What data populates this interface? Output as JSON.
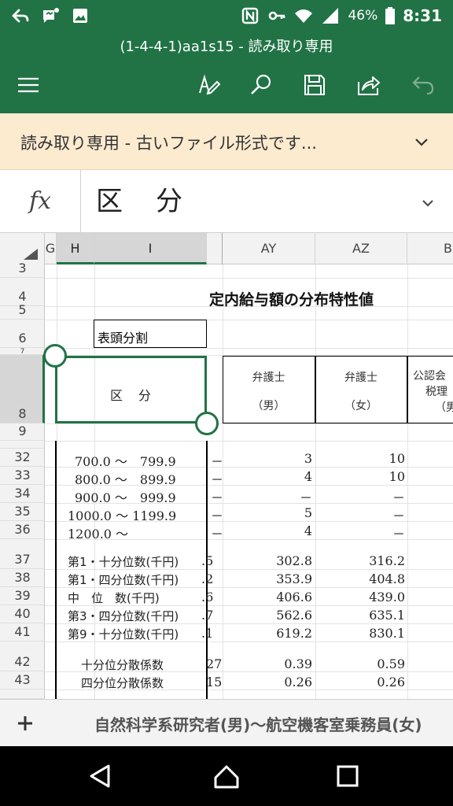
{
  "status": {
    "battery": "46%",
    "time": "8:31",
    "icons": [
      "back-arrow-icon",
      "messenger-icon",
      "image-icon",
      "nfc-icon",
      "key-icon",
      "wifi-icon",
      "signal-icon",
      "battery-icon"
    ]
  },
  "appbar": {
    "title": "(1-4-4-1)aa1s15 - 読み取り専用",
    "icons": [
      "menu-icon",
      "draw-icon",
      "search-icon",
      "save-icon",
      "share-icon",
      "undo-icon"
    ]
  },
  "banner": {
    "text": "読み取り専用 - 古いファイル形式です..."
  },
  "formula": {
    "fx": "fx",
    "value": "区　分"
  },
  "columns": [
    "G",
    "H",
    "I",
    "AY",
    "AZ",
    "B"
  ],
  "rows": {
    "r3": "3",
    "r4": "4",
    "r5": "5",
    "r6": "6",
    "r7": "7",
    "r8": "8",
    "r9": "9",
    "r32": "32",
    "r33": "33",
    "r34": "34",
    "r35": "35",
    "r36": "36",
    "r37": "37",
    "r38": "38",
    "r39": "39",
    "r40": "40",
    "r41": "41",
    "r42": "42",
    "r43": "43"
  },
  "cells": {
    "title": "定内給与額の分布特性値",
    "hyoto": "表頭分割",
    "kubun": "区　分",
    "ay_header1": "弁護士",
    "ay_header2": "（男）",
    "az_header1": "弁護士",
    "az_header2": "（女）",
    "b_header1": "公認会",
    "b_header2": "税理",
    "b_header3": "（男"
  },
  "data_rows": [
    {
      "label": "700.0 ～　799.9",
      "h": "－",
      "ay": "3",
      "az": "10"
    },
    {
      "label": "800.0 ～　899.9",
      "h": "－",
      "ay": "4",
      "az": "10"
    },
    {
      "label": "900.0 ～　999.9",
      "h": "－",
      "ay": "－",
      "az": "－"
    },
    {
      "label": "1000.0 ～ 1199.9",
      "h": "－",
      "ay": "5",
      "az": "－"
    },
    {
      "label": "1200.0 ～",
      "h": "－",
      "ay": "4",
      "az": "－"
    },
    {
      "label": "第1・十分位数(千円)",
      "h": ".5",
      "ay": "302.8",
      "az": "316.2"
    },
    {
      "label": "第1・四分位数(千円)",
      "h": ".2",
      "ay": "353.9",
      "az": "404.8"
    },
    {
      "label": "中　位　数(千円)",
      "h": ".6",
      "ay": "406.6",
      "az": "439.0"
    },
    {
      "label": "第3・四分位数(千円)",
      "h": ".7",
      "ay": "562.6",
      "az": "635.1"
    },
    {
      "label": "第9・十分位数(千円)",
      "h": ".1",
      "ay": "619.2",
      "az": "830.1"
    },
    {
      "label": "十分位分散係数",
      "h": "27",
      "ay": "0.39",
      "az": "0.59"
    },
    {
      "label": "四分位分散係数",
      "h": "15",
      "ay": "0.26",
      "az": "0.26"
    }
  ],
  "sheet_tab": {
    "add": "+",
    "name": "自然科学系研究者(男)～航空機客室乗務員(女)"
  },
  "colors": {
    "excel_green": "#217346",
    "banner_bg": "#fdebd0"
  }
}
